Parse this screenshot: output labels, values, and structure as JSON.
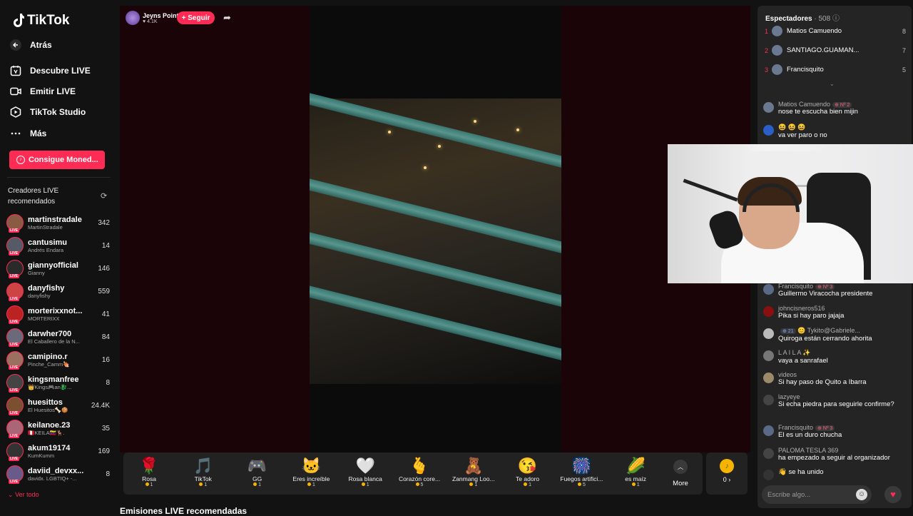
{
  "sidebar": {
    "logo": "TikTok",
    "back": "Atrás",
    "nav": [
      {
        "label": "Descubre LIVE",
        "icon": "calendar-live-icon"
      },
      {
        "label": "Emitir LIVE",
        "icon": "video-camera-icon"
      },
      {
        "label": "TikTok Studio",
        "icon": "studio-icon"
      },
      {
        "label": "Más",
        "icon": "more-dots-icon"
      }
    ],
    "coins_button": "Consigue Moned...",
    "creators_title": "Creadores LIVE recomendados",
    "creators": [
      {
        "name": "martinstradale",
        "sub": "MartinStradale",
        "count": "342",
        "color": "#8a5a44"
      },
      {
        "name": "cantusimu",
        "sub": "Andrés Endara",
        "count": "14",
        "color": "#555a66"
      },
      {
        "name": "giannyofficial",
        "sub": "Gianny",
        "count": "146",
        "color": "#2a2a2a"
      },
      {
        "name": "danyfishy",
        "sub": "danyfishy",
        "count": "559",
        "color": "#c44"
      },
      {
        "name": "morterixxnot...",
        "sub": "MORTERIXX",
        "count": "41",
        "color": "#b22"
      },
      {
        "name": "darwher700",
        "sub": "El Caballero de la N...",
        "count": "84",
        "color": "#6a6a7a"
      },
      {
        "name": "camipino.r",
        "sub": "Pinche_Camm🍖",
        "count": "16",
        "color": "#9a7060"
      },
      {
        "name": "kingsmanfree",
        "sub": "👑Kings🎮an🐉...",
        "count": "8",
        "color": "#444"
      },
      {
        "name": "huesittos",
        "sub": "El Huesitos🦴🍪",
        "count": "24.4K",
        "color": "#7a5030"
      },
      {
        "name": "keilanoe.23",
        "sub": "🇵🇪KEILA🇻🇪🦌.",
        "count": "35",
        "color": "#aa6677"
      },
      {
        "name": "akum19174",
        "sub": "KumKumm",
        "count": "169",
        "color": "#333"
      },
      {
        "name": "daviid_devxx...",
        "sub": "davidx. LGBTIQ+ -...",
        "count": "8",
        "color": "#6a5a8a"
      }
    ],
    "see_all": "Ver todo"
  },
  "host": {
    "name": "Jeyns Point",
    "likes": "4.1K",
    "follow": "+ Seguir"
  },
  "gifts": [
    {
      "name": "Rosa",
      "price": "1",
      "icon": "🌹"
    },
    {
      "name": "TikTok",
      "price": "1",
      "icon": "🎵"
    },
    {
      "name": "GG",
      "price": "1",
      "icon": "🎮"
    },
    {
      "name": "Eres increíble",
      "price": "1",
      "icon": "🐱"
    },
    {
      "name": "Rosa blanca",
      "price": "1",
      "icon": "🤍"
    },
    {
      "name": "Corazón core...",
      "price": "5",
      "icon": "🫰"
    },
    {
      "name": "Zanmang Loo...",
      "price": "1",
      "icon": "🧸"
    },
    {
      "name": "Te adoro",
      "price": "1",
      "icon": "😘"
    },
    {
      "name": "Fuegos artifici...",
      "price": "5",
      "icon": "🎆"
    },
    {
      "name": "es maíz",
      "price": "1",
      "icon": "🌽"
    }
  ],
  "more_label": "More",
  "wallet": "0 ›",
  "recommended_title": "Emisiones LIVE recomendadas",
  "panel": {
    "title": "Espectadores",
    "count": "· 508",
    "viewers": [
      {
        "rank": "1",
        "name": "Matios Camuendo",
        "score": "8"
      },
      {
        "rank": "2",
        "name": "SANTIAGO.GUAMAN...",
        "score": "7"
      },
      {
        "rank": "3",
        "name": "Francisquito",
        "score": "5"
      }
    ],
    "messages_top": [
      {
        "user": "Matios Camuendo",
        "badge": "⊕ Nº 2",
        "text": "nose te escucha bien mijin",
        "color": "#6a7890"
      },
      {
        "user": "😆 😆 😆",
        "badge": "",
        "text": "va ver paro o no",
        "color": "#2a5fc8"
      }
    ],
    "messages": [
      {
        "user": "Francisquito",
        "badge": "⊕ Nº 3",
        "text": "Guillermo Viracocha presidente",
        "color": "#5a6a86"
      },
      {
        "user": "johncisneros516",
        "badge": "",
        "text": "Pika si hay paro jajaja",
        "color": "#8a1010"
      },
      {
        "user": "😊 Tykito@Gabriele...",
        "badge": "⊕ 21",
        "text": "Quiroga están cerrando ahorita",
        "color": "#bbb"
      },
      {
        "user": "L A I L A ✨",
        "badge": "",
        "text": "vaya a sanrafael",
        "color": "#777"
      },
      {
        "user": "videos",
        "badge": "",
        "text": "Si hay paso de Quito a Ibarra",
        "color": "#9a8a6a"
      },
      {
        "user": "lazyeye",
        "badge": "",
        "text": "Si echa piedra para seguirle confirme?",
        "color": "#444"
      },
      {
        "user": "Francisquito",
        "badge": "⊕ Nº 3",
        "text": "El es un duro chucha",
        "color": "#5a6a86"
      },
      {
        "user": "PALOMA TESLA 369",
        "badge": "",
        "text": " ha empezado a seguir al organizador",
        "color": "#444"
      },
      {
        "user": "",
        "badge": "",
        "text": "👋 se ha unido",
        "color": "#333"
      }
    ],
    "input_placeholder": "Escribe algo..."
  }
}
